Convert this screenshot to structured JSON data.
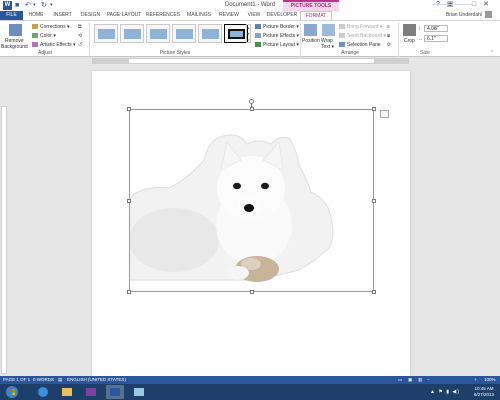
{
  "window": {
    "doc_title": "Document1 - Word",
    "context_tab_group": "PICTURE TOOLS",
    "controls": {
      "help": "?",
      "ribbon_display": "▣",
      "minimize": "–",
      "maximize": "□",
      "close": "✕"
    }
  },
  "tabs": [
    "FILE",
    "HOME",
    "INSERT",
    "DESIGN",
    "PAGE LAYOUT",
    "REFERENCES",
    "MAILINGS",
    "REVIEW",
    "VIEW",
    "DEVELOPER",
    "FORMAT"
  ],
  "user_name": "Brian Underdahl",
  "ribbon": {
    "adjust": {
      "label": "Adjust",
      "remove_background": "Remove\nBackground",
      "corrections": "Corrections ▾",
      "color": "Color ▾",
      "artistic_effects": "Artistic Effects ▾"
    },
    "picture_styles": {
      "label": "Picture Styles",
      "picture_border": "Picture Border ▾",
      "picture_effects": "Picture Effects ▾",
      "picture_layout": "Picture Layout ▾"
    },
    "arrange": {
      "label": "Arrange",
      "position": "Position",
      "wrap_text": "Wrap\nText ▾",
      "bring_forward": "Bring Forward ▾",
      "send_backward": "Send Backward ▾",
      "selection_pane": "Selection Pane"
    },
    "size": {
      "label": "Size",
      "crop": "Crop",
      "height": "4.08\"",
      "width": "6.1\""
    }
  },
  "status": {
    "page": "PAGE 1 OF 1",
    "words": "0 WORDS",
    "language": "ENGLISH (UNITED STATES)",
    "zoom": "100%"
  },
  "taskbar": {
    "time": "10:45 AM",
    "date": "6/27/2013"
  },
  "colors": {
    "word_blue": "#2b579a",
    "picture_tools_accent": "#c3308f",
    "taskbar": "#1f3f6b"
  }
}
